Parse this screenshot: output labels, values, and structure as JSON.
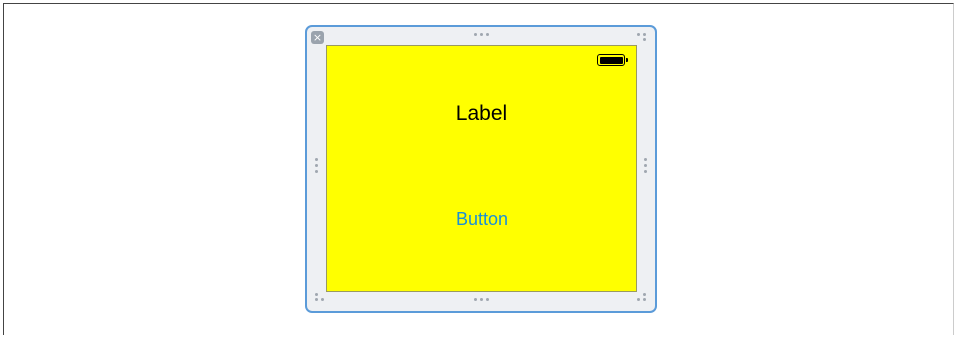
{
  "scene": {
    "close_glyph": "×",
    "close_icon_name": "close-icon",
    "frame_border_color": "#5b9bd9"
  },
  "view_controller": {
    "background_color": "#ffff00",
    "status_bar": {
      "icon": "battery-icon"
    },
    "label_text": "Label",
    "button_text": "Button",
    "button_color": "#1a8fd6"
  }
}
